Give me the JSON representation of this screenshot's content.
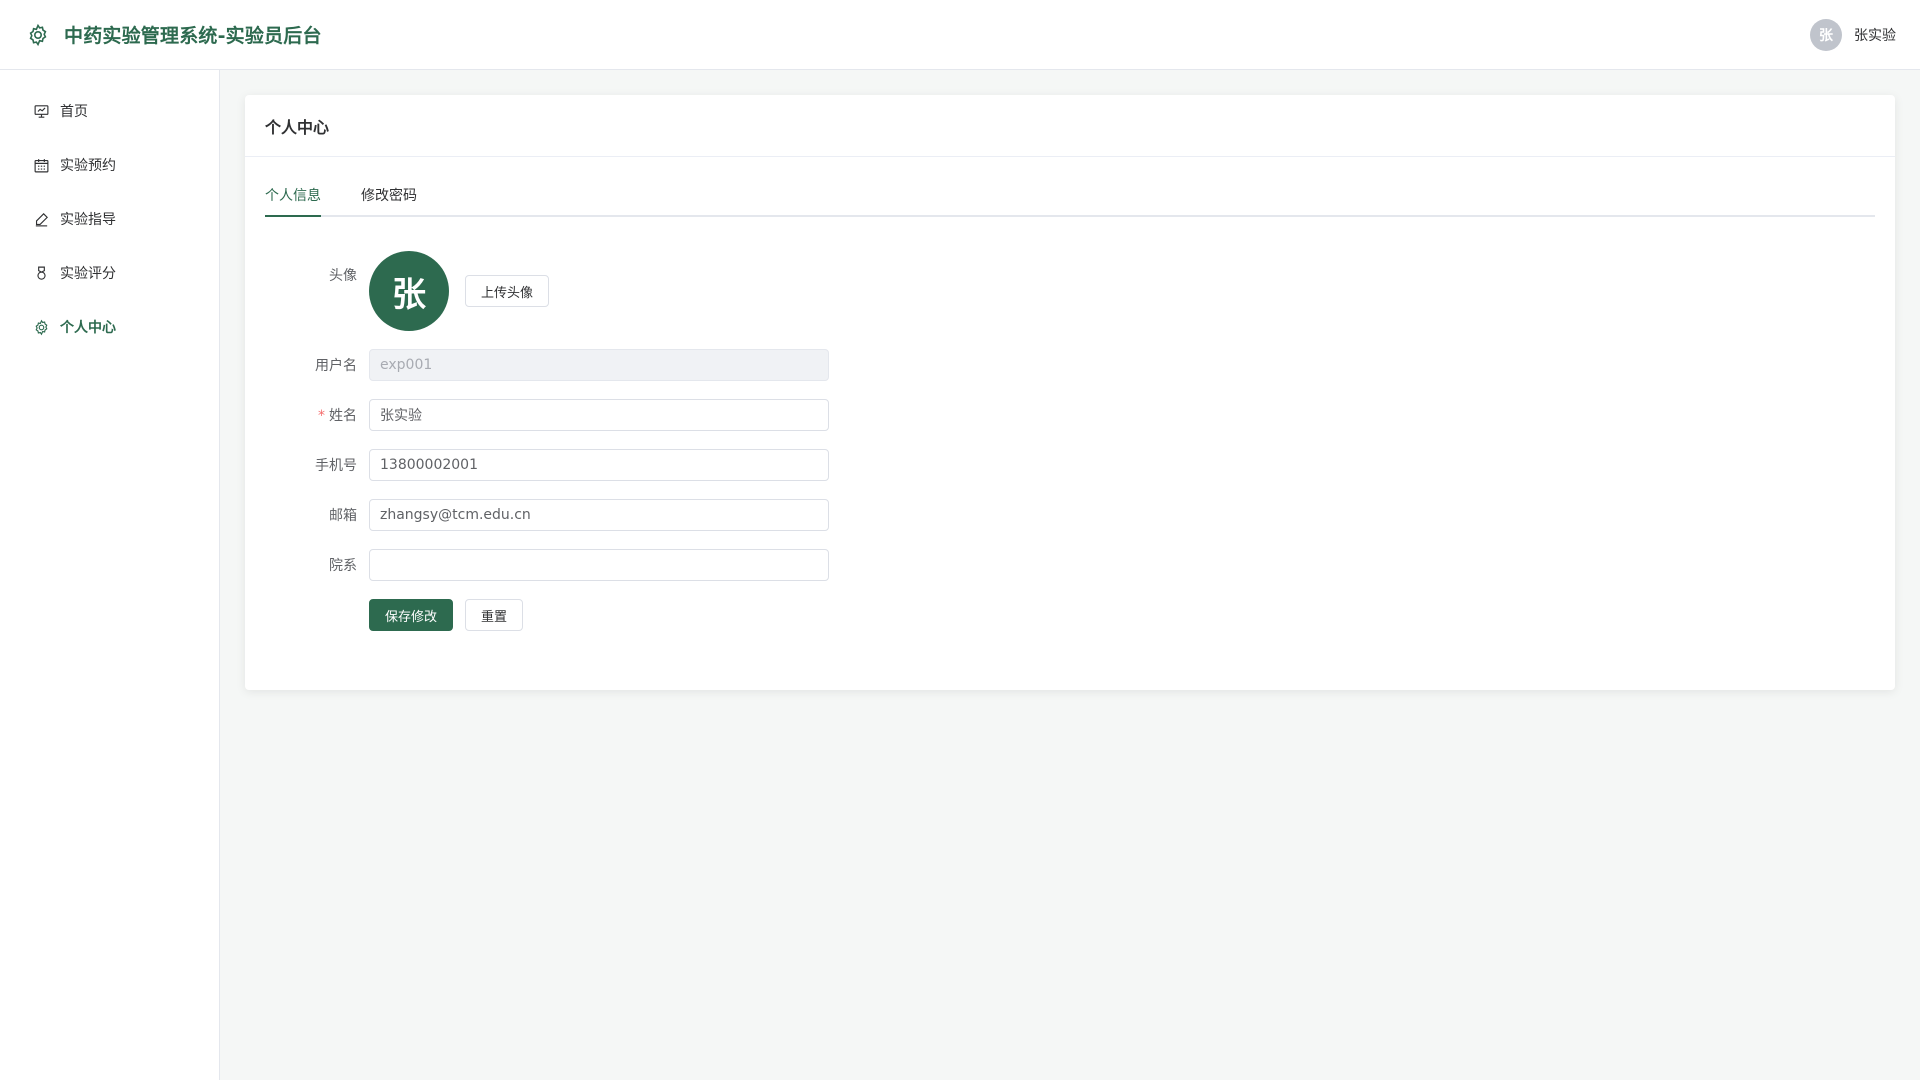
{
  "header": {
    "title": "中药实验管理系统-实验员后台",
    "brand_icon": "gear-icon",
    "user_avatar_text": "张",
    "user_name": "张实验"
  },
  "sidebar": {
    "items": [
      {
        "label": "首页",
        "icon": "dashboard-icon",
        "active": false
      },
      {
        "label": "实验预约",
        "icon": "calendar-icon",
        "active": false
      },
      {
        "label": "实验指导",
        "icon": "edit-icon",
        "active": false
      },
      {
        "label": "实验评分",
        "icon": "medal-icon",
        "active": false
      },
      {
        "label": "个人中心",
        "icon": "gear-icon",
        "active": true
      }
    ]
  },
  "main": {
    "card_title": "个人中心",
    "tabs": [
      {
        "label": "个人信息",
        "active": true
      },
      {
        "label": "修改密码",
        "active": false
      }
    ],
    "form": {
      "avatar_label": "头像",
      "avatar_text": "张",
      "upload_label": "上传头像",
      "username_label": "用户名",
      "username_value": "exp001",
      "name_required_mark": "*",
      "name_label": "姓名",
      "name_value": "张实验",
      "phone_label": "手机号",
      "phone_value": "13800002001",
      "email_label": "邮箱",
      "email_value": "zhangsy@tcm.edu.cn",
      "department_label": "院系",
      "department_value": "",
      "save_label": "保存修改",
      "reset_label": "重置"
    }
  },
  "colors": {
    "accent": "#2d6a4f",
    "required": "#f56c6c",
    "background": "#f5f7f6"
  }
}
